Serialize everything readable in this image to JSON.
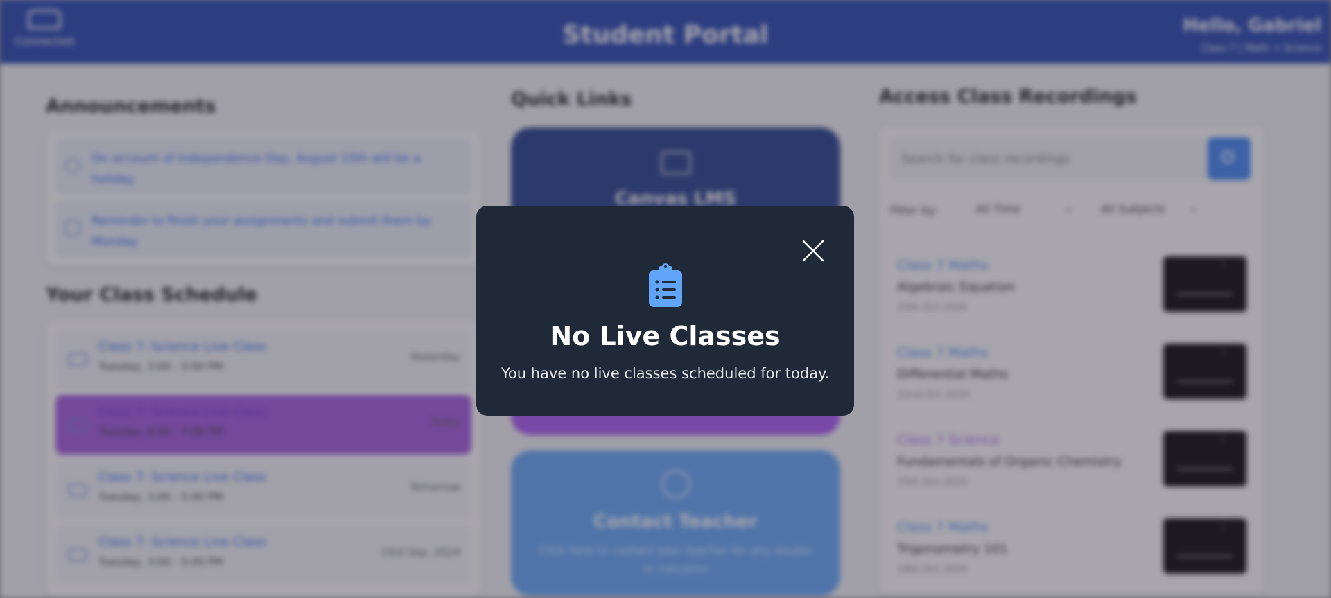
{
  "header": {
    "logo_text": "Connected",
    "title": "Student Portal",
    "greeting": "Hello, Gabriel",
    "greeting_sub": "Class 7 | Math + Science"
  },
  "announcements": {
    "title": "Announcements",
    "items": [
      {
        "text": "On account of Independence Day, August 15th will be a holiday",
        "icon": "info-icon"
      },
      {
        "text": "Reminder to finish your assignments and submit them by Monday",
        "icon": "calendar-icon"
      }
    ]
  },
  "schedule": {
    "title": "Your Class Schedule",
    "items": [
      {
        "name": "Class 7: Science Live Class",
        "time": "Tuesday, 3:00 - 5:00 PM",
        "when": "Yesterday"
      },
      {
        "name": "Class 7: Science Live Class",
        "time": "Tuesday, 6:00 - 7:00 PM",
        "when": "Today"
      },
      {
        "name": "Class 7: Science Live Class",
        "time": "Tuesday, 3:00 - 5:00 PM",
        "when": "Tomorrow"
      },
      {
        "name": "Class 7: Science Live Class",
        "time": "Tuesday, 3:00 - 5:00 PM",
        "when": "23rd Sep, 2024"
      }
    ]
  },
  "quick_links": {
    "title": "Quick Links",
    "items": [
      {
        "title": "Canvas LMS",
        "desc": "",
        "color": "#1e3a8a",
        "icon": "screen-icon"
      },
      {
        "title": "",
        "desc": "",
        "color": "#a855f7",
        "icon": ""
      },
      {
        "title": "Contact Teacher",
        "desc": "Click here to contact your teacher for any doubts or concerns",
        "color": "#60a5fa",
        "icon": "whatsapp-icon"
      }
    ]
  },
  "recordings": {
    "title": "Access Class Recordings",
    "search_placeholder": "Search for class recordings",
    "filter_label": "Filter by:",
    "time_filter": "All Time",
    "subject_filter": "All Subjects",
    "items": [
      {
        "class": "Class 7 Maths",
        "topic": "Algebraic Equation",
        "date": "20th Oct 2024",
        "accent": "#3b82f6"
      },
      {
        "class": "Class 7 Maths",
        "topic": "Differential Maths",
        "date": "22nd Oct 2024",
        "accent": "#3b82f6"
      },
      {
        "class": "Class 7 Science",
        "topic": "Fundamentals of Organic Chemistry",
        "date": "25th Oct 2024",
        "accent": "#a855f7"
      },
      {
        "class": "Class 7 Maths",
        "topic": "Trigonometry 101",
        "date": "18th Oct 2024",
        "accent": "#3b82f6"
      }
    ]
  },
  "modal": {
    "icon": "clipboard-list-icon",
    "title": "No Live Classes",
    "message": "You have no live classes scheduled for today.",
    "close_icon": "close-icon"
  },
  "colors": {
    "header": "#1e40af",
    "modal_bg": "#1f2937",
    "clipboard": "#60a5fa",
    "active_class": "#a055e0"
  }
}
